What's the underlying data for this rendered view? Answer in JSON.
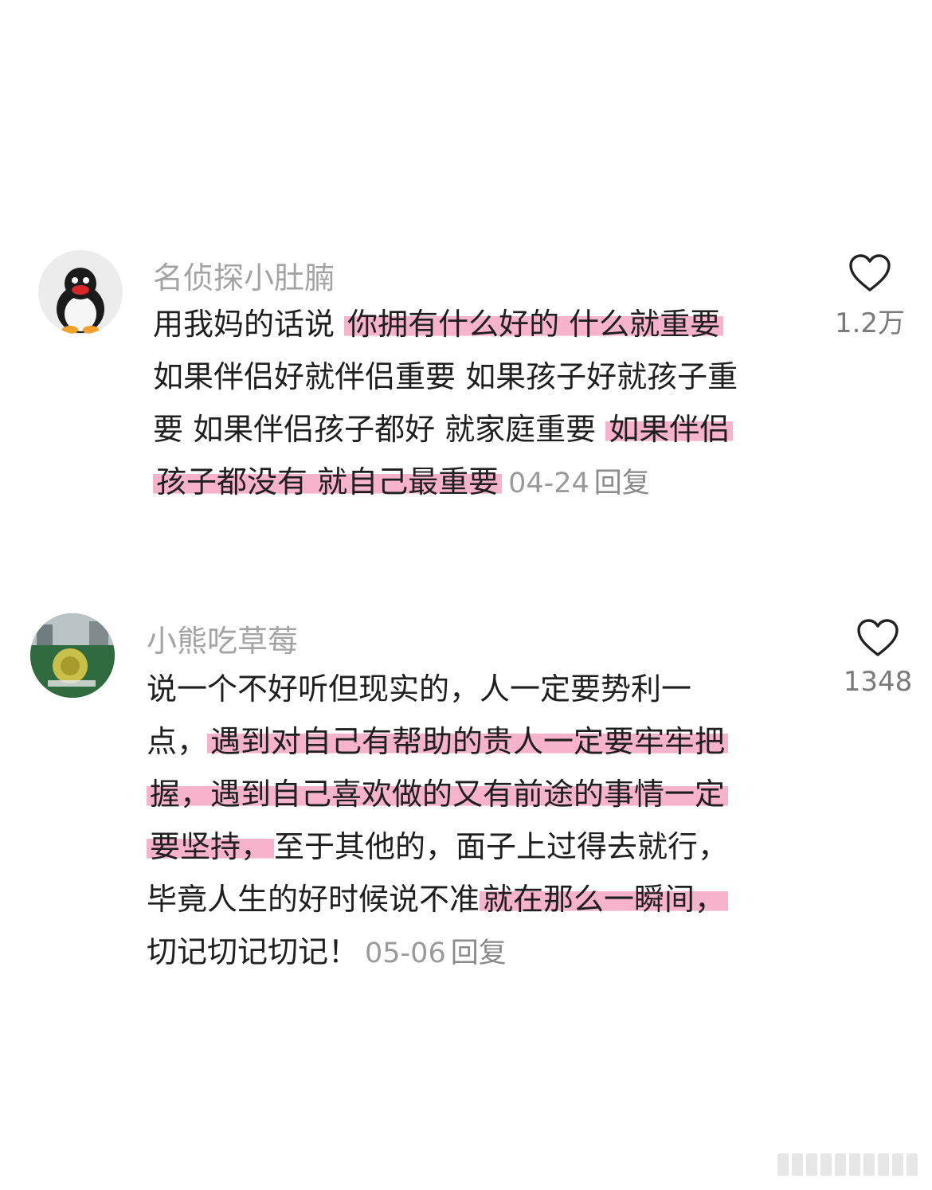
{
  "comments": [
    {
      "username": "名侦探小肚腩",
      "lines": [
        [
          {
            "t": "用我妈的话说 ",
            "h": false
          },
          {
            "t": "你拥有什么好的 什么就重要",
            "h": true
          }
        ],
        [
          {
            "t": "如果伴侣好就伴侣重要 如果孩子好就孩子重",
            "h": false
          }
        ],
        [
          {
            "t": "要 如果伴侣孩子都好 就家庭重要 ",
            "h": false
          },
          {
            "t": "如果伴侣",
            "h": true
          }
        ],
        [
          {
            "t": "孩子都没有 就自己最重要",
            "h": true
          }
        ]
      ],
      "date": "04-24",
      "reply_label": "回复",
      "like_count": "1.2万"
    },
    {
      "username": "小熊吃草莓",
      "lines": [
        [
          {
            "t": "说一个不好听但现实的，人一定要势利一",
            "h": false
          }
        ],
        [
          {
            "t": "点，",
            "h": false
          },
          {
            "t": "遇到对自己有帮助的贵人一定要牢牢把",
            "h": true
          }
        ],
        [
          {
            "t": "握，遇到自己喜欢做的又有前途的事情一定",
            "h": true
          }
        ],
        [
          {
            "t": "要坚持，",
            "h": true
          },
          {
            "t": "至于其他的，面子上过得去就行，",
            "h": false
          }
        ],
        [
          {
            "t": "毕竟人生的好时候说不准",
            "h": false
          },
          {
            "t": "就在那么一瞬间，",
            "h": true
          }
        ],
        [
          {
            "t": "切记切记切记！",
            "h": false
          }
        ]
      ],
      "date": "05-06",
      "reply_label": "回复",
      "like_count": "1348"
    }
  ],
  "icons": {
    "like": "heart-outline-icon",
    "avatar1": "penguin-avatar",
    "avatar2": "photo-avatar"
  },
  "colors": {
    "highlight": "#f7b3cc",
    "username": "#a3a3a3",
    "meta": "#9a9a9a"
  }
}
